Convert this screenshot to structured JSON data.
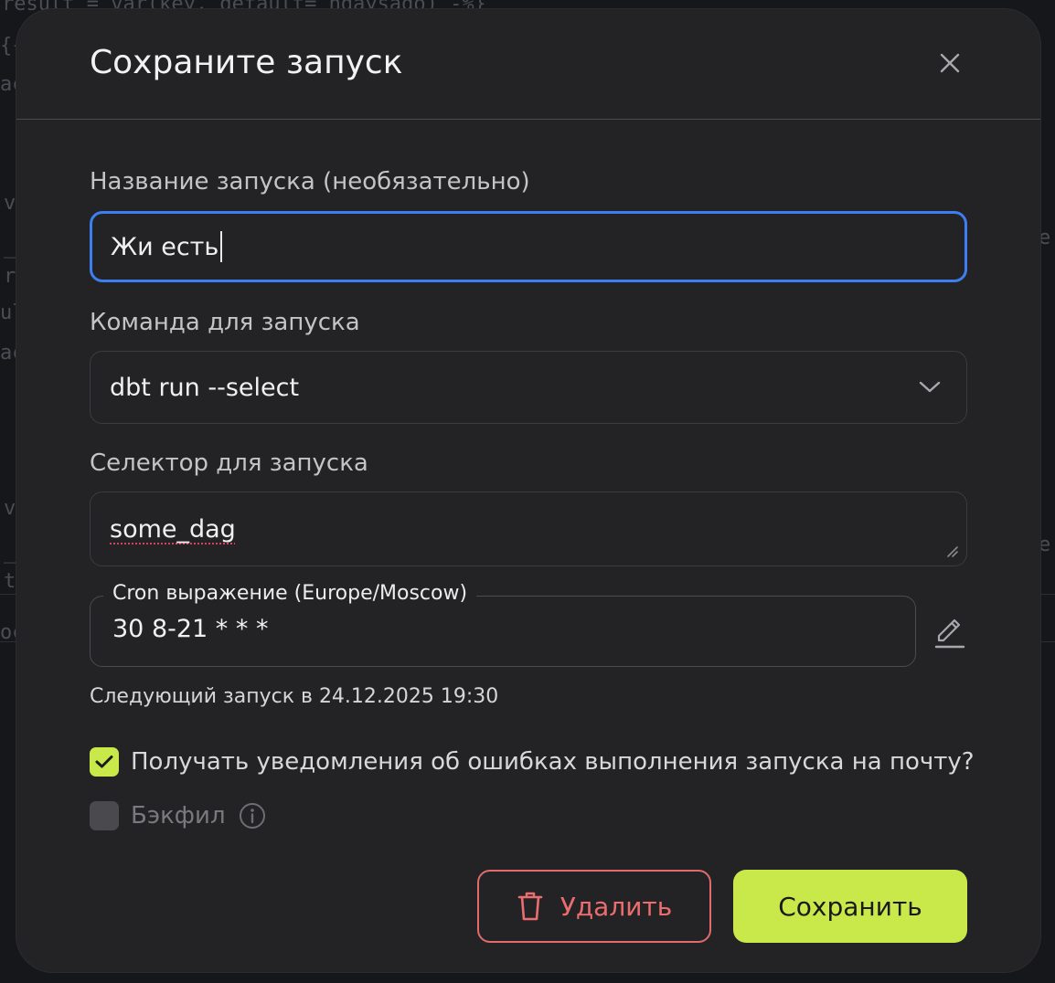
{
  "modal": {
    "title": "Сохраните запуск"
  },
  "form": {
    "name": {
      "label": "Название запуска (необязательно)",
      "value": "Жи есть"
    },
    "command": {
      "label": "Команда для запуска",
      "selected": "dbt run --select"
    },
    "selector": {
      "label": "Селектор для запуска",
      "value": "some_dag"
    },
    "cron": {
      "label": "Cron выражение (Europe/Moscow)",
      "value": "30 8-21 * * *"
    },
    "next_run": "Следующий запуск в 24.12.2025 19:30",
    "notify_errors": {
      "label": "Получать уведомления об ошибках выполнения запуска на почту?",
      "checked": true
    },
    "backfill": {
      "label": "Бэкфил",
      "checked": false,
      "disabled": true
    }
  },
  "buttons": {
    "delete": "Удалить",
    "save": "Сохранить"
  },
  "icons": {
    "close": "close-icon",
    "chevron": "chevron-down-icon",
    "edit": "pencil-icon",
    "check": "check-icon",
    "info": "info-icon",
    "trash": "trash-icon"
  },
  "colors": {
    "accent": "#c9e84a",
    "focus": "#3d7ef0",
    "danger": "#ec6d6f",
    "modal_bg": "#232325"
  }
}
